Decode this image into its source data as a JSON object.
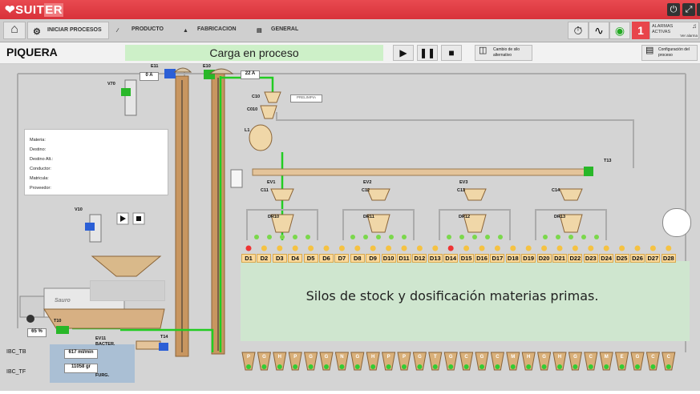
{
  "app": {
    "brand_pre": "SUIT",
    "brand_hl": "ER"
  },
  "nav": {
    "items": [
      {
        "label": "INICIAR PROCESOS"
      },
      {
        "label": "PRODUCTO"
      },
      {
        "label": "FABRICACION"
      },
      {
        "label": "GENERAL"
      }
    ],
    "alarm_count": "1",
    "alarm_label_1": "ALARMAS",
    "alarm_label_2": "ACTIVAS",
    "alarm_link": "Ver alarma"
  },
  "header": {
    "title": "PIQUERA",
    "status": "Carga en proceso",
    "cambio_label_1": "Cambio de silo",
    "cambio_label_2": "alternativo",
    "config_label_1": "Configuración del",
    "config_label_2": "proceso"
  },
  "info": {
    "fields": [
      "Materia:",
      "Destino:",
      "Destino Alt.:",
      "Conductor:",
      "Matricula:",
      "Proveedor:"
    ]
  },
  "equipment": {
    "e11": "E11",
    "e11_val": "0 A",
    "e10": "E10",
    "e10_val": "22 A",
    "v70": "V70",
    "v10": "V10",
    "c10": "C10",
    "c010": "C010",
    "l1": "L1",
    "prelimpia": "PRELIMPIA",
    "t13": "T13",
    "ev1": "EV1",
    "ev2": "EV2",
    "ev3": "EV3",
    "c11": "C11",
    "c12": "C12",
    "c13": "C13",
    "c14": "C14",
    "dr10": "DR10",
    "dr11": "DR11",
    "dr12": "DR12",
    "dr13": "DR13",
    "t10": "T10",
    "t10_val": "65 %",
    "ev11": "EV11",
    "bacter": "BACTER.",
    "t14": "T14",
    "ibc_tb": "IBC_TB",
    "ibc_tf": "IBC_TF",
    "flow_val": "617 ml/min",
    "weight_val": "11058 gr",
    "furg": "FURG.",
    "truck_brand": "Sauro"
  },
  "silos": {
    "labels": [
      "D1",
      "D2",
      "D3",
      "D4",
      "D5",
      "D6",
      "D7",
      "D8",
      "D9",
      "D10",
      "D11",
      "D12",
      "D13",
      "D14",
      "D15",
      "D16",
      "D17",
      "D18",
      "D19",
      "D20",
      "D21",
      "D22",
      "D23",
      "D24",
      "D25",
      "D26",
      "D27",
      "D28"
    ],
    "caption": "Silos de stock y dosificación materias primas.",
    "bottom_letters": [
      "P",
      "G",
      "H",
      "P",
      "G",
      "G",
      "N",
      "G",
      "H",
      "P",
      "P",
      "G",
      "T",
      "G",
      "C",
      "G",
      "C",
      "M",
      "H",
      "G",
      "H",
      "G",
      "C",
      "M",
      "E",
      "G",
      "C",
      "C"
    ]
  },
  "colors": {
    "accent_red": "#d8323a",
    "line_green": "#22cc22",
    "status_green": "#cdf0c8",
    "silo_orange": "#fbd99a"
  }
}
